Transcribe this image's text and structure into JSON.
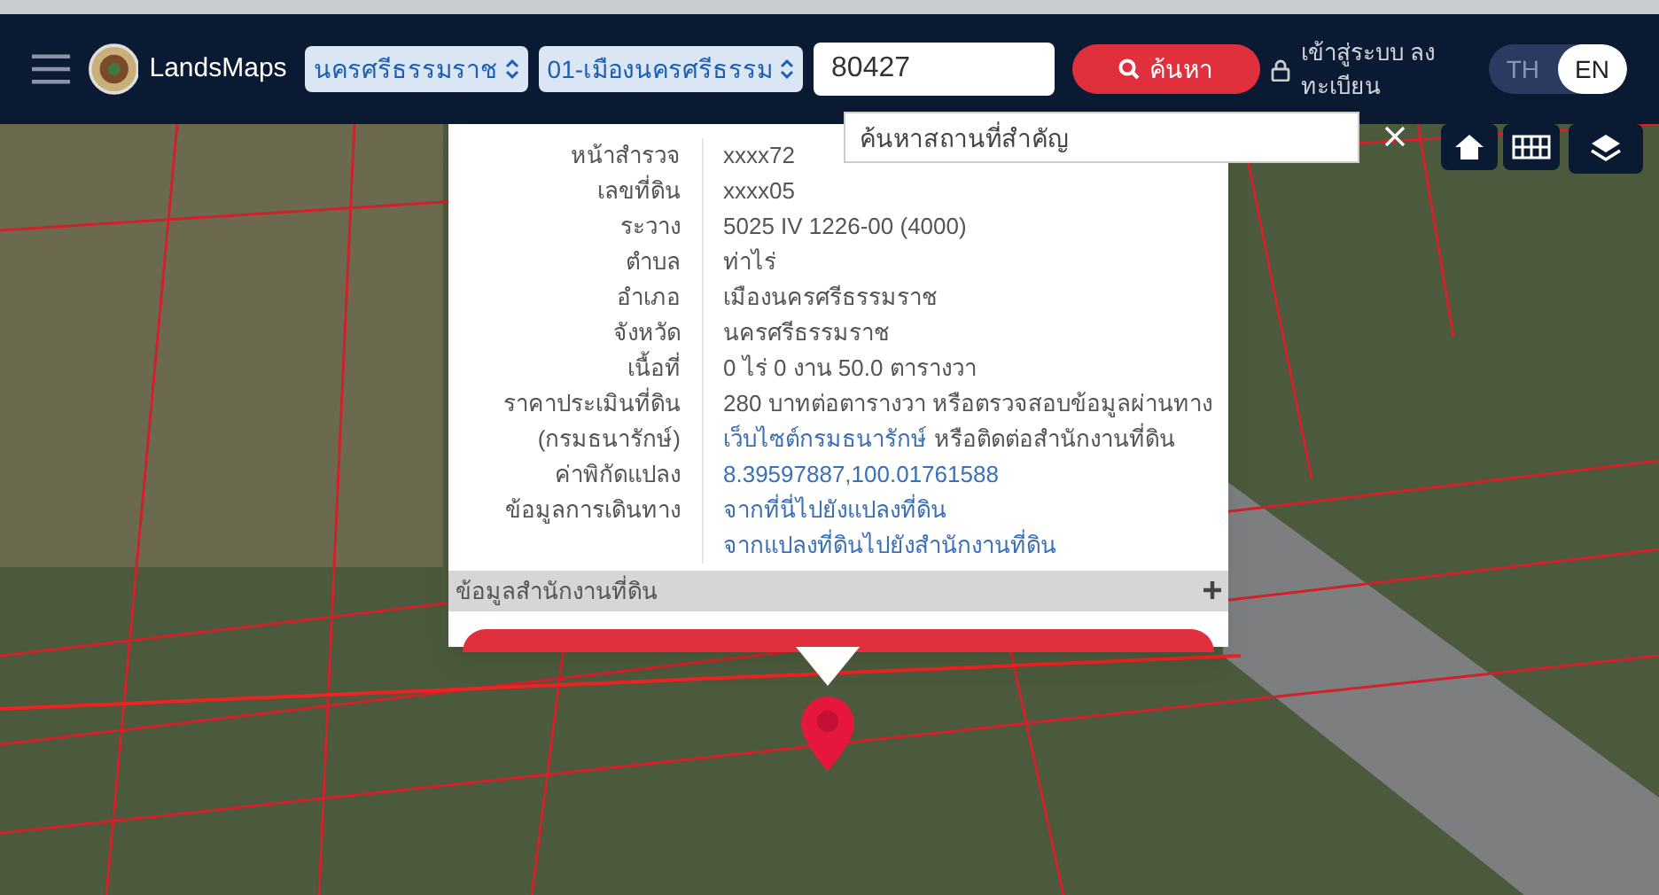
{
  "header": {
    "logo_text": "LandsMaps",
    "province_select": "นครศรีธรรมราช",
    "district_select": "01-เมืองนครศรีธรรม",
    "search_value": "80427",
    "search_button": "ค้นหา",
    "login_lines": [
      "เข้าสู่ระบบ ลง",
      "ทะเบียน"
    ],
    "languages": [
      {
        "label": "TH",
        "selected": false
      },
      {
        "label": "EN",
        "selected": true
      }
    ]
  },
  "place_search": {
    "placeholder": "ค้นหาสถานที่สำคัญ"
  },
  "popup": {
    "rows": [
      {
        "label": "หน้าสำรวจ",
        "lines": [
          [
            {
              "kind": "text",
              "text": "xxxx72"
            }
          ]
        ]
      },
      {
        "label": "เลขที่ดิน",
        "lines": [
          [
            {
              "kind": "text",
              "text": "xxxx05"
            }
          ]
        ]
      },
      {
        "label": "ระวาง",
        "lines": [
          [
            {
              "kind": "text",
              "text": "5025 IV 1226-00 (4000)"
            }
          ]
        ]
      },
      {
        "label": "ตำบล",
        "lines": [
          [
            {
              "kind": "text",
              "text": "ท่าไร่"
            }
          ]
        ]
      },
      {
        "label": "อำเภอ",
        "lines": [
          [
            {
              "kind": "text",
              "text": "เมืองนครศรีธรรมราช"
            }
          ]
        ]
      },
      {
        "label": "จังหวัด",
        "lines": [
          [
            {
              "kind": "text",
              "text": "นครศรีธรรมราช"
            }
          ]
        ]
      },
      {
        "label": "เนื้อที่",
        "lines": [
          [
            {
              "kind": "text",
              "text": "0 ไร่ 0 งาน 50.0 ตารางวา"
            }
          ]
        ]
      },
      {
        "label": "ราคาประเมินที่ดิน",
        "lines": [
          [
            {
              "kind": "text",
              "text": "280 บาทต่อตารางวา หรือตรวจสอบข้อมูลผ่านทาง"
            }
          ]
        ]
      },
      {
        "label": "(กรมธนารักษ์)",
        "lines": [
          [
            {
              "kind": "link",
              "text": "เว็บไซต์กรมธนารักษ์"
            },
            {
              "kind": "text",
              "text": "หรือติดต่อสำนักงานที่ดิน"
            }
          ]
        ]
      },
      {
        "label": "ค่าพิกัดแปลง",
        "lines": [
          [
            {
              "kind": "link",
              "text": "8.39597887,100.01761588"
            }
          ]
        ]
      },
      {
        "label": "ข้อมูลการเดินทาง",
        "lines": [
          [
            {
              "kind": "link",
              "text": "จากที่นี่ไปยังแปลงที่ดิน"
            }
          ],
          [
            {
              "kind": "link",
              "text": "จากแปลงที่ดินไปยังสำนักงานที่ดิน"
            }
          ]
        ]
      }
    ],
    "section": {
      "title": "ข้อมูลสำนักงานที่ดิน",
      "expanded": false
    }
  }
}
